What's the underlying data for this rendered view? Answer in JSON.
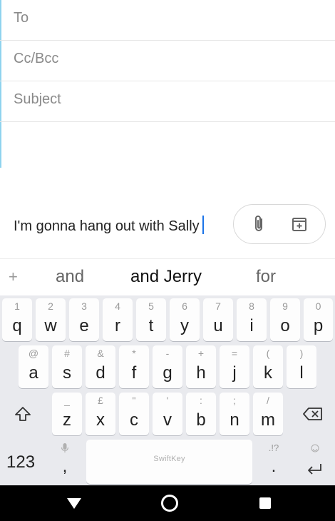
{
  "compose": {
    "to_placeholder": "To",
    "cc_placeholder": "Cc/Bcc",
    "subject_placeholder": "Subject",
    "body_text": "I'm gonna hang out with Sally"
  },
  "actions": {
    "attach_icon": "paperclip-icon",
    "calendar_icon": "calendar-add-icon"
  },
  "suggestions": {
    "plus": "+",
    "items": [
      "and",
      "and Jerry",
      "for"
    ]
  },
  "keyboard": {
    "row1": [
      {
        "main": "q",
        "sec": "1"
      },
      {
        "main": "w",
        "sec": "2"
      },
      {
        "main": "e",
        "sec": "3"
      },
      {
        "main": "r",
        "sec": "4"
      },
      {
        "main": "t",
        "sec": "5"
      },
      {
        "main": "y",
        "sec": "6"
      },
      {
        "main": "u",
        "sec": "7"
      },
      {
        "main": "i",
        "sec": "8"
      },
      {
        "main": "o",
        "sec": "9"
      },
      {
        "main": "p",
        "sec": "0"
      }
    ],
    "row2": [
      {
        "main": "a",
        "sec": "@"
      },
      {
        "main": "s",
        "sec": "#"
      },
      {
        "main": "d",
        "sec": "&"
      },
      {
        "main": "f",
        "sec": "*"
      },
      {
        "main": "g",
        "sec": "-"
      },
      {
        "main": "h",
        "sec": "+"
      },
      {
        "main": "j",
        "sec": "="
      },
      {
        "main": "k",
        "sec": "("
      },
      {
        "main": "l",
        "sec": ")"
      }
    ],
    "row3": [
      {
        "main": "z",
        "sec": "_"
      },
      {
        "main": "x",
        "sec": "£"
      },
      {
        "main": "c",
        "sec": "\""
      },
      {
        "main": "v",
        "sec": "'"
      },
      {
        "main": "b",
        "sec": ":"
      },
      {
        "main": "n",
        "sec": ";"
      },
      {
        "main": "m",
        "sec": "/"
      }
    ],
    "numbers_label": "123",
    "comma": ",",
    "period": ".",
    "period_sec": ".!?",
    "space_logo": "SwiftKey",
    "shift_icon": "shift-icon",
    "backspace_icon": "backspace-icon",
    "mic_icon": "mic-icon",
    "enter_icon": "enter-icon",
    "emoji_icon": "emoji-icon"
  },
  "navbar": {
    "back_icon": "back-triangle-icon",
    "home_icon": "home-circle-icon",
    "recent_icon": "recent-square-icon"
  }
}
